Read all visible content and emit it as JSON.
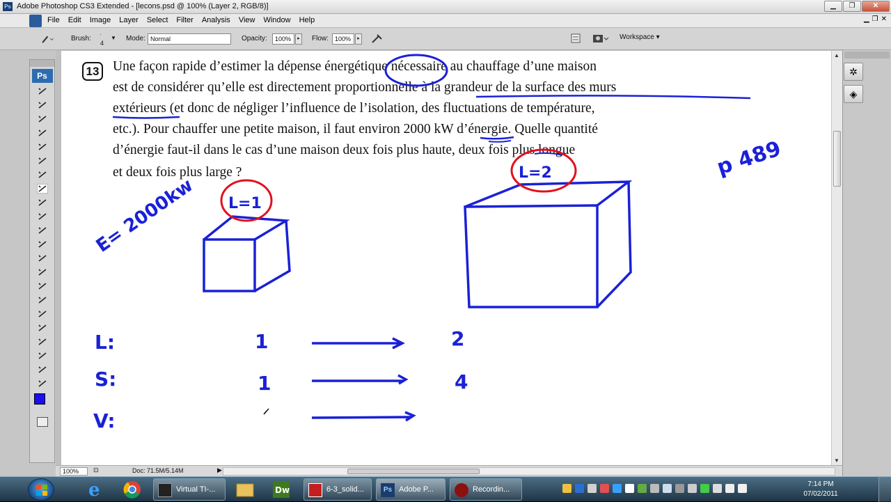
{
  "window": {
    "title": "Adobe Photoshop CS3 Extended - [lecons.psd @ 100% (Layer 2, RGB/8)]",
    "minimize": "▁",
    "maximize": "❐",
    "close": "✕"
  },
  "menu": {
    "items": [
      "File",
      "Edit",
      "Image",
      "Layer",
      "Select",
      "Filter",
      "Analysis",
      "View",
      "Window",
      "Help"
    ]
  },
  "options": {
    "brush_label": "Brush:",
    "brush_size": "4",
    "mode_label": "Mode:",
    "mode_value": "Normal",
    "opacity_label": "Opacity:",
    "opacity_value": "100%",
    "flow_label": "Flow:",
    "flow_value": "100%",
    "workspace_label": "Workspace ▾"
  },
  "toolbox": {
    "badge": "Ps",
    "tools": [
      "move-tool",
      "marquee-tool",
      "lasso-tool",
      "magic-wand-tool",
      "crop-tool",
      "slice-tool",
      "healing-tool",
      "brush-tool",
      "stamp-tool",
      "history-brush-tool",
      "eraser-tool",
      "bucket-tool",
      "blur-tool",
      "dodge-tool",
      "pen-tool",
      "type-tool",
      "path-select-tool",
      "shape-tool",
      "notes-tool",
      "eyedropper-tool",
      "hand-tool",
      "zoom-tool"
    ]
  },
  "document": {
    "question_number": "13",
    "lines": [
      "Une façon rapide d’estimer la dépense énergétique nécessaire au chauffage d’une maison",
      "est de considérer qu’elle est directement proportionnelle à la grandeur de la surface des murs",
      "extérieurs (et donc de négliger l’influence de l’isolation, des fluctuations de température,",
      "etc.). Pour chauffer une petite maison, il faut environ 2000 kW d’énergie. Quelle quantité",
      "d’énergie faut-il dans le cas d’une maison deux fois plus haute, deux fois plus longue",
      "et deux fois plus large ?"
    ],
    "annotations": {
      "energy_note": "E= 2000kw",
      "page_ref": "p 489",
      "small_house_label": "L=1",
      "big_house_label": "L=2",
      "row_labels": [
        "L:",
        "S:",
        "V:"
      ],
      "start_values": [
        "1",
        "1",
        ""
      ],
      "end_values": [
        "2",
        "4",
        ""
      ]
    },
    "ink_color": "#1a21d6",
    "highlight_color": "#e01020"
  },
  "status": {
    "zoom": "100%",
    "doc_info": "Doc: 71.5M/5.14M"
  },
  "taskbar": {
    "apps": [
      {
        "label": "Virtual TI-..."
      },
      {
        "label": "6-3_solid..."
      },
      {
        "label": "Adobe P..."
      },
      {
        "label": "Recordin..."
      }
    ],
    "time": "7:14 PM",
    "date": "07/02/2011"
  }
}
